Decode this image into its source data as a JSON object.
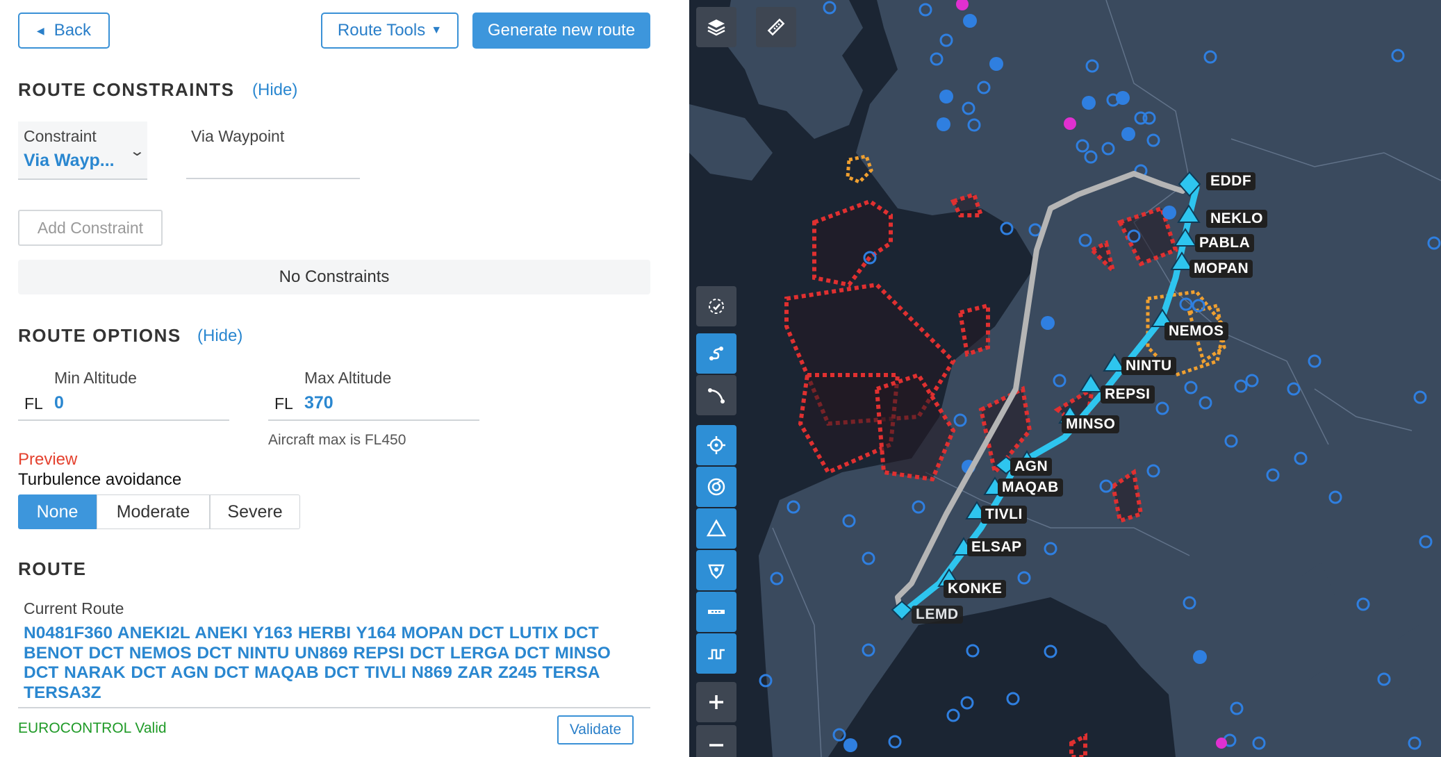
{
  "toolbar": {
    "back_label": "Back",
    "route_tools_label": "Route Tools",
    "generate_label": "Generate new route"
  },
  "constraints": {
    "title": "ROUTE CONSTRAINTS",
    "hide_label": "(Hide)",
    "constraint_label": "Constraint",
    "constraint_value": "Via Wayp...",
    "via_waypoint_label": "Via Waypoint",
    "via_waypoint_value": "",
    "add_label": "Add Constraint",
    "empty_text": "No Constraints"
  },
  "options": {
    "title": "ROUTE OPTIONS",
    "hide_label": "(Hide)",
    "min_alt_label": "Min Altitude",
    "min_alt_prefix": "FL",
    "min_alt_value": "0",
    "max_alt_label": "Max Altitude",
    "max_alt_prefix": "FL",
    "max_alt_value": "370",
    "aircraft_max_note": "Aircraft max is FL450",
    "preview_label": "Preview",
    "turbulence_label": "Turbulence avoidance",
    "turbulence_options": [
      "None",
      "Moderate",
      "Severe"
    ],
    "turbulence_selected": "None"
  },
  "route": {
    "title": "ROUTE",
    "current_label": "Current Route",
    "current_value": "N0481F360 ANEKI2L ANEKI Y163 HERBI Y164 MOPAN DCT LUTIX DCT BENOT DCT NEMOS DCT NINTU UN869 REPSI DCT LERGA DCT MINSO DCT NARAK DCT AGN DCT MAQAB DCT TIVLI N869 ZAR Z245 TERSA TERSA3Z",
    "validation_status": "EUROCONTROL Valid",
    "validate_label": "Validate"
  },
  "map": {
    "waypoints": [
      {
        "id": "EDDF",
        "label": "EDDF"
      },
      {
        "id": "NEKLO",
        "label": "NEKLO"
      },
      {
        "id": "PABLA",
        "label": "PABLA"
      },
      {
        "id": "MOPAN",
        "label": "MOPAN"
      },
      {
        "id": "NEMOS",
        "label": "NEMOS"
      },
      {
        "id": "NINTU",
        "label": "NINTU"
      },
      {
        "id": "REPSI",
        "label": "REPSI"
      },
      {
        "id": "MINSO",
        "label": "MINSO"
      },
      {
        "id": "AGN",
        "label": "AGN"
      },
      {
        "id": "MAQAB",
        "label": "MAQAB"
      },
      {
        "id": "TIVLI",
        "label": "TIVLI"
      },
      {
        "id": "ELSAP",
        "label": "ELSAP"
      },
      {
        "id": "KONKE",
        "label": "KONKE"
      },
      {
        "id": "DEST",
        "label": "LEMD"
      }
    ],
    "colors": {
      "background": "#1b2533",
      "land": "#3a4a5e",
      "route_current": "#b5b5b5",
      "route_new": "#2ec5ef",
      "restricted": "#e03030",
      "caution": "#f0a030",
      "navaid": "#2f7fe0"
    },
    "icon_names": {
      "layers": "layers-icon",
      "ruler": "ruler-icon",
      "select": "lasso-select-icon",
      "route": "route-icon",
      "curve": "arc-icon",
      "vor": "vor-icon",
      "ndb": "ndb-icon",
      "triangle": "waypoint-triangle-icon",
      "airport": "airport-icon",
      "runway": "runway-icon",
      "profile": "vertical-profile-icon",
      "zoom_in": "zoom-in-icon",
      "zoom_out": "zoom-out-icon"
    }
  }
}
